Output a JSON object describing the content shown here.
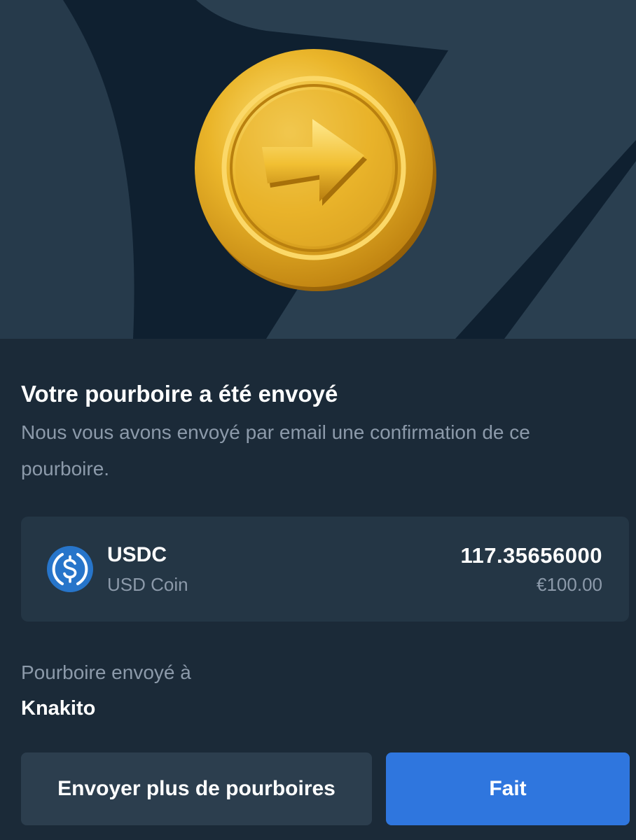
{
  "hero": {
    "image": "gold-coin-arrow-icon",
    "colors": {
      "background": "#0f2030",
      "shape": "#2a3f50",
      "coin": "#e9b423"
    }
  },
  "confirmation": {
    "title": "Votre pourboire a été envoyé",
    "subtitle": "Nous vous avons envoyé par email une confirmation de ce pourboire."
  },
  "asset": {
    "icon": "usdc-icon",
    "symbol": "USDC",
    "name": "USD Coin",
    "amount": "117.35656000",
    "fiat_value": "€100.00"
  },
  "recipient": {
    "label": "Pourboire envoyé à",
    "name": "Knakito"
  },
  "actions": {
    "send_more_label": "Envoyer plus de pourboires",
    "done_label": "Fait"
  },
  "colors": {
    "page_background": "#1b2a38",
    "card_background": "#243645",
    "secondary_button": "#2c3e4e",
    "primary_button": "#2f76de",
    "muted_text": "#8c9aaa",
    "usdc_blue": "#2775ca"
  }
}
